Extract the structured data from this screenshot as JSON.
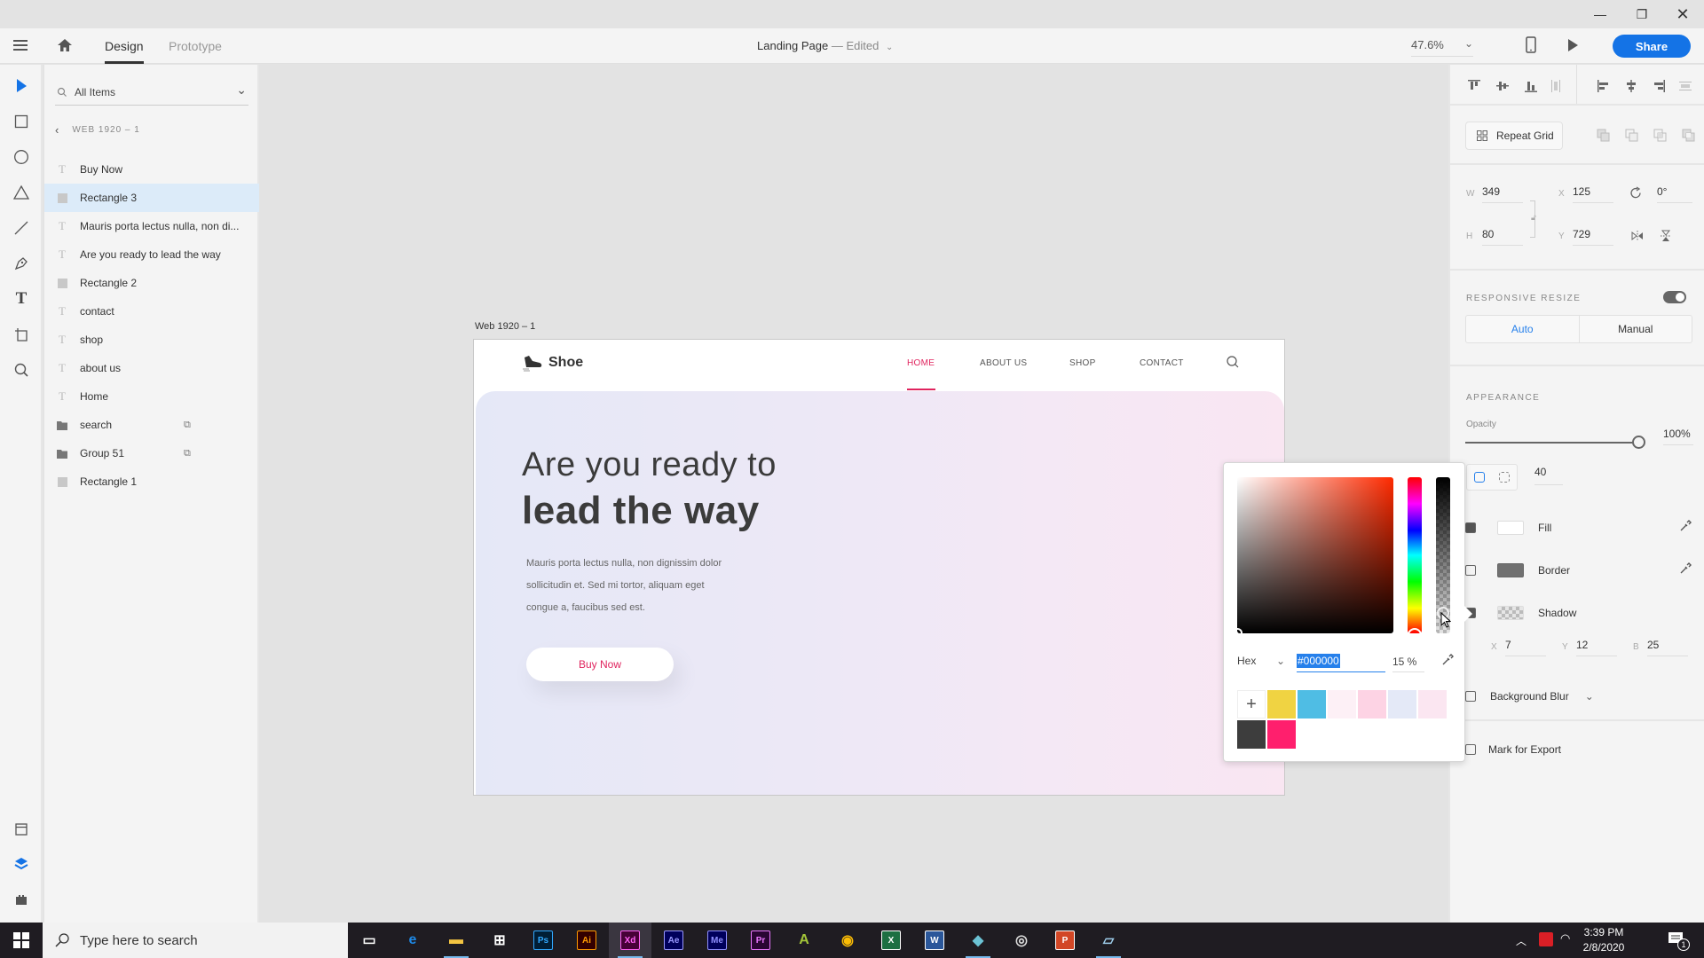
{
  "window": {
    "minimize_icon": "minimize-icon",
    "maximize_icon": "restore-icon",
    "close_icon": "close-icon"
  },
  "appbar": {
    "tabs": [
      {
        "label": "Design",
        "active": true
      },
      {
        "label": "Prototype",
        "active": false
      }
    ],
    "document_title": "Landing Page",
    "separator": "—",
    "document_status": "Edited",
    "zoom_level": "47.6%",
    "share_label": "Share"
  },
  "layers": {
    "filter_label": "All Items",
    "artboard_name": "WEB 1920 – 1",
    "items": [
      {
        "label": "Buy Now",
        "type": "text",
        "selected": false
      },
      {
        "label": "Rectangle 3",
        "type": "rectangle",
        "selected": true
      },
      {
        "label": "Mauris porta lectus nulla, non di...",
        "type": "text",
        "selected": false
      },
      {
        "label": "Are you ready to  lead the way",
        "type": "text",
        "selected": false
      },
      {
        "label": "Rectangle 2",
        "type": "rectangle",
        "selected": false
      },
      {
        "label": "contact",
        "type": "text",
        "selected": false
      },
      {
        "label": "shop",
        "type": "text",
        "selected": false
      },
      {
        "label": "about us",
        "type": "text",
        "selected": false
      },
      {
        "label": "Home",
        "type": "text",
        "selected": false
      },
      {
        "label": "search",
        "type": "group",
        "selected": false,
        "linked": true
      },
      {
        "label": "Group 51",
        "type": "group",
        "selected": false,
        "linked": true
      },
      {
        "label": "Rectangle 1",
        "type": "rectangle",
        "selected": false
      }
    ]
  },
  "canvas": {
    "artboard_label": "Web 1920 – 1",
    "site": {
      "logo_text": "Shoe",
      "nav": [
        {
          "label": "HOME",
          "active": true
        },
        {
          "label": "ABOUT US",
          "active": false
        },
        {
          "label": "SHOP",
          "active": false
        },
        {
          "label": "CONTACT",
          "active": false
        }
      ],
      "hero_line1": "Are you ready to",
      "hero_line2": "lead the way",
      "hero_body_lines": [
        "Mauris porta lectus nulla, non dignissim dolor",
        "sollicitudin et. Sed mi tortor, aliquam eget",
        "congue a, faucibus sed est."
      ],
      "cta_label": "Buy Now",
      "accent_color": "#e0245e"
    }
  },
  "color_picker": {
    "mode": "Hex",
    "hex_value": "#000000",
    "alpha": "15 %",
    "hue_color": "#ff2a00",
    "swatches": [
      "#f0d342",
      "#4fbde4",
      "#fdf0f6",
      "#fdd3e4",
      "#e4e9f7",
      "#fbe6f1",
      "#3d3d3d",
      "#ff1f6d"
    ]
  },
  "properties": {
    "repeat_grid_label": "Repeat Grid",
    "w_label": "W",
    "w": "349",
    "h_label": "H",
    "h": "80",
    "x_label": "X",
    "x": "125",
    "y_label": "Y",
    "y": "729",
    "rotation": "0°",
    "responsive_resize_title": "RESPONSIVE RESIZE",
    "responsive_resize_on": true,
    "resize_modes": [
      "Auto",
      "Manual"
    ],
    "resize_mode_active": "Auto",
    "appearance_title": "APPEARANCE",
    "opacity_label": "Opacity",
    "opacity_value": "100%",
    "corner_radius": "40",
    "fill": {
      "label": "Fill",
      "checked": true,
      "color": "#ffffff"
    },
    "border": {
      "label": "Border",
      "checked": false,
      "color": "#707070"
    },
    "shadow": {
      "label": "Shadow",
      "checked": true,
      "x_label": "X",
      "x": "7",
      "y_label": "Y",
      "y": "12",
      "b_label": "B",
      "b": "25"
    },
    "background_blur": {
      "label": "Background Blur",
      "checked": false
    },
    "export": {
      "label": "Mark for Export",
      "checked": false
    }
  },
  "taskbar": {
    "search_placeholder": "Type here to search",
    "apps": [
      {
        "name": "task-view",
        "glyph": "▭"
      },
      {
        "name": "edge",
        "glyph": "e",
        "color": "#1e88e5"
      },
      {
        "name": "file-explorer",
        "glyph": "▬",
        "color": "#f4c542",
        "running": true
      },
      {
        "name": "store",
        "glyph": "⊞",
        "color": "#fff"
      },
      {
        "name": "photoshop",
        "glyph": "Ps",
        "color": "#31a8ff",
        "bg": "#001e36"
      },
      {
        "name": "illustrator",
        "glyph": "Ai",
        "color": "#ff9a00",
        "bg": "#330000"
      },
      {
        "name": "xd",
        "glyph": "Xd",
        "color": "#ff61f6",
        "bg": "#470137",
        "running": true,
        "active": true
      },
      {
        "name": "after-effects",
        "glyph": "Ae",
        "color": "#9999ff",
        "bg": "#00005b"
      },
      {
        "name": "media-encoder",
        "glyph": "Me",
        "color": "#8f8fff",
        "bg": "#00005b"
      },
      {
        "name": "premiere",
        "glyph": "Pr",
        "color": "#ea77ff",
        "bg": "#2a0634"
      },
      {
        "name": "android-studio",
        "glyph": "A",
        "color": "#a4c639"
      },
      {
        "name": "chrome",
        "glyph": "◉",
        "color": "#fbbc05"
      },
      {
        "name": "excel",
        "glyph": "X",
        "color": "#fff",
        "bg": "#1d6f42"
      },
      {
        "name": "word",
        "glyph": "W",
        "color": "#fff",
        "bg": "#2b579a"
      },
      {
        "name": "app-diamond",
        "glyph": "◆",
        "color": "#6cc3d5",
        "running": true
      },
      {
        "name": "obs",
        "glyph": "◎",
        "color": "#ddd"
      },
      {
        "name": "powerpoint",
        "glyph": "P",
        "color": "#fff",
        "bg": "#d24726"
      },
      {
        "name": "notepad",
        "glyph": "▱",
        "color": "#9ccbe8",
        "running": true
      }
    ],
    "time": "3:39 PM",
    "date": "2/8/2020",
    "notification_count": "1"
  }
}
